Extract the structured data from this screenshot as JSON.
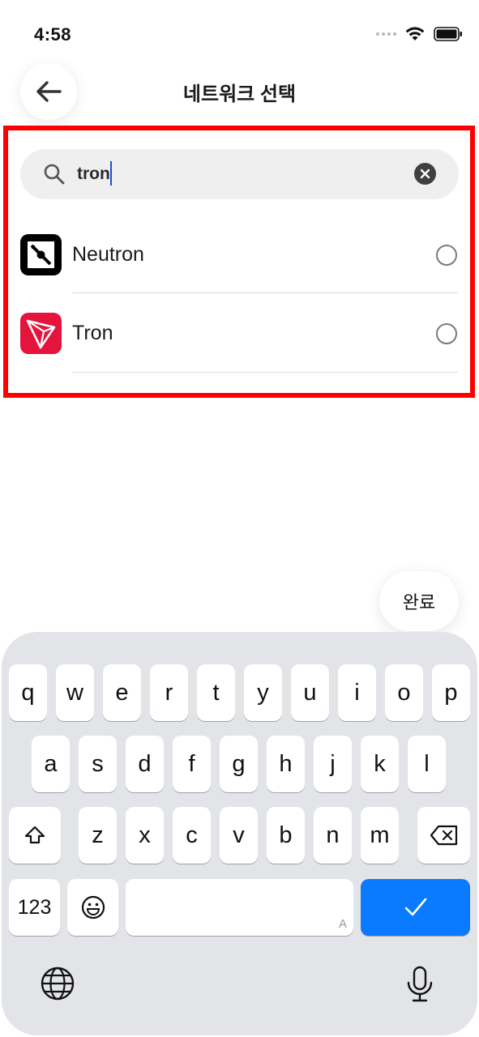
{
  "status": {
    "time": "4:58"
  },
  "header": {
    "title": "네트워크 선택"
  },
  "search": {
    "value": "tron"
  },
  "networks": [
    {
      "label": "Neutron"
    },
    {
      "label": "Tron"
    }
  ],
  "done_button": {
    "label": "완료"
  },
  "keyboard": {
    "row1": [
      "q",
      "w",
      "e",
      "r",
      "t",
      "y",
      "u",
      "i",
      "o",
      "p"
    ],
    "row2": [
      "a",
      "s",
      "d",
      "f",
      "g",
      "h",
      "j",
      "k",
      "l"
    ],
    "row3": [
      "z",
      "x",
      "c",
      "v",
      "b",
      "n",
      "m"
    ],
    "numbers_label": "123",
    "return_symbol": "✓",
    "space_hint": "A"
  },
  "colors": {
    "highlight": "#ff0000",
    "return_key": "#0a7aff",
    "tron_brand": "#e5143c"
  }
}
